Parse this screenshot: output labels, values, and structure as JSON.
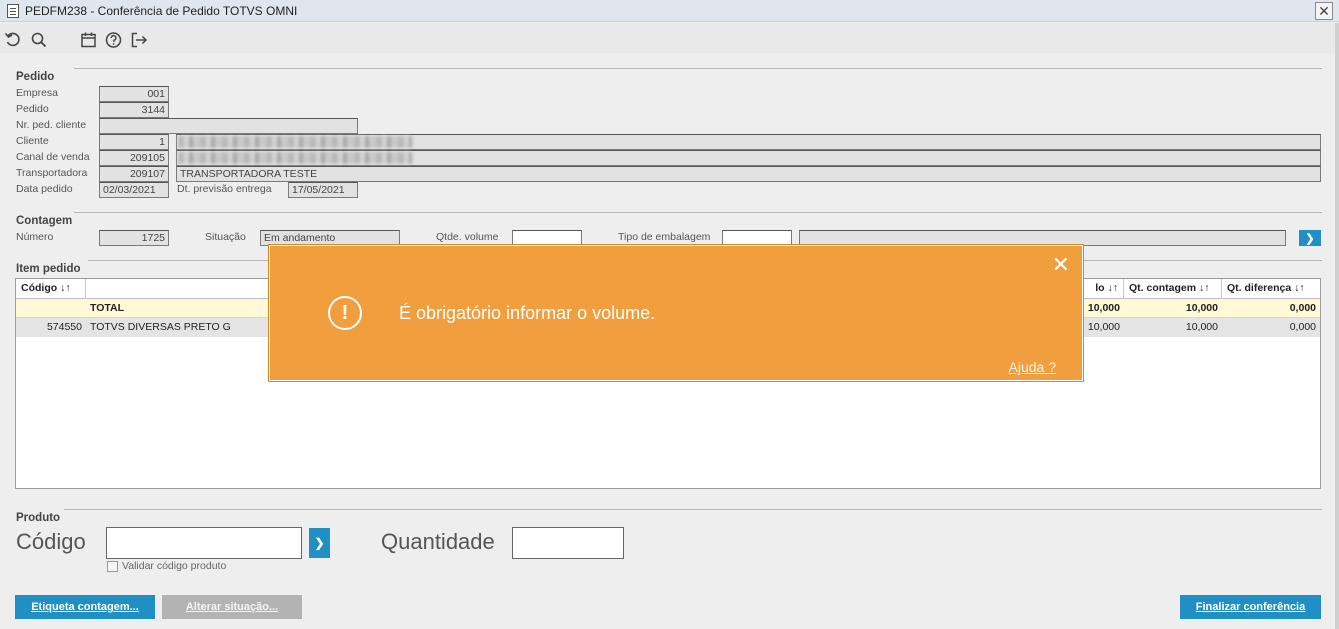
{
  "window": {
    "title": "PEDFM238 - Conferência de Pedido TOTVS OMNI",
    "close": "✕"
  },
  "pedido": {
    "section": "Pedido",
    "empresa_label": "Empresa",
    "empresa": "001",
    "pedido_label": "Pedido",
    "pedido": "3144",
    "nr_cliente_label": "Nr. ped. cliente",
    "nr_cliente": "",
    "cliente_label": "Cliente",
    "cliente": "1",
    "canal_label": "Canal de venda",
    "canal": "209105",
    "transp_label": "Transportadora",
    "transp": "209107",
    "transp_nome": "TRANSPORTADORA TESTE",
    "data_label": "Data pedido",
    "data": "02/03/2021",
    "prev_label": "Dt. previsão entrega",
    "prev": "17/05/2021"
  },
  "contagem": {
    "section": "Contagem",
    "numero_label": "Número",
    "numero": "1725",
    "situacao_label": "Situação",
    "situacao": "Em andamento",
    "volume_label": "Qtde. volume",
    "volume": "",
    "embalagem_label": "Tipo de embalagem",
    "embalagem": "",
    "embalagem_desc": ""
  },
  "item": {
    "section": "Item pedido",
    "headers": {
      "codigo": "Código ↓↑",
      "qt_pedido": "lo ↓↑",
      "qt_contagem": "Qt. contagem ↓↑",
      "qt_diferenca": "Qt. diferença ↓↑"
    },
    "total": {
      "label": "TOTAL",
      "qt_pedido": "10,000",
      "qt_contagem": "10,000",
      "qt_diferenca": "0,000"
    },
    "rows": [
      {
        "codigo": "574550",
        "descricao": "TOTVS DIVERSAS PRETO G",
        "qt_pedido": "10,000",
        "qt_contagem": "10,000",
        "qt_diferenca": "0,000"
      }
    ]
  },
  "produto": {
    "section": "Produto",
    "codigo_label": "Código",
    "codigo": "",
    "quantidade_label": "Quantidade",
    "quantidade": "",
    "validar_label": "Validar código produto"
  },
  "buttons": {
    "etiqueta": "Etiqueta contagem...",
    "alterar": "Alterar situação...",
    "finalizar": "Finalizar conferência"
  },
  "toast": {
    "message": "É obrigatório informar o volume.",
    "help": "Ajuda ?",
    "close": "✕",
    "alert": "!"
  },
  "icons": [
    "undo-icon",
    "search-icon",
    "calendar-icon",
    "help-icon",
    "exit-icon"
  ],
  "colors": {
    "accent": "#1f8fc4",
    "toast": "#f09e3e",
    "total_row": "#fff8d6"
  }
}
